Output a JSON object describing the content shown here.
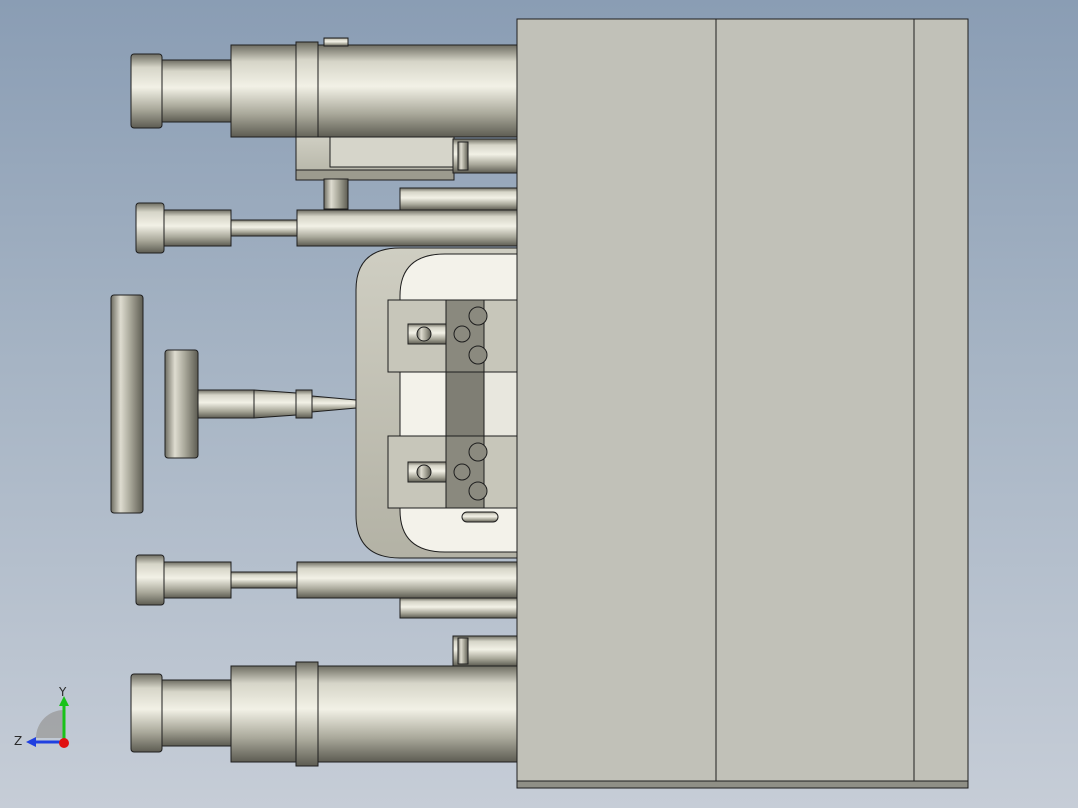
{
  "viewport": {
    "background_top": "#8a9db4",
    "background_bottom": "#c6cdd7"
  },
  "model": {
    "metal_color": "#b8b7a8",
    "plate_color": "#c1c1b8",
    "edge_color": "#1e1e1e"
  },
  "triad": {
    "y_label": "Y",
    "z_label": "Z",
    "y_color": "#19c219",
    "z_color": "#2040e0",
    "x_color": "#e01010"
  }
}
